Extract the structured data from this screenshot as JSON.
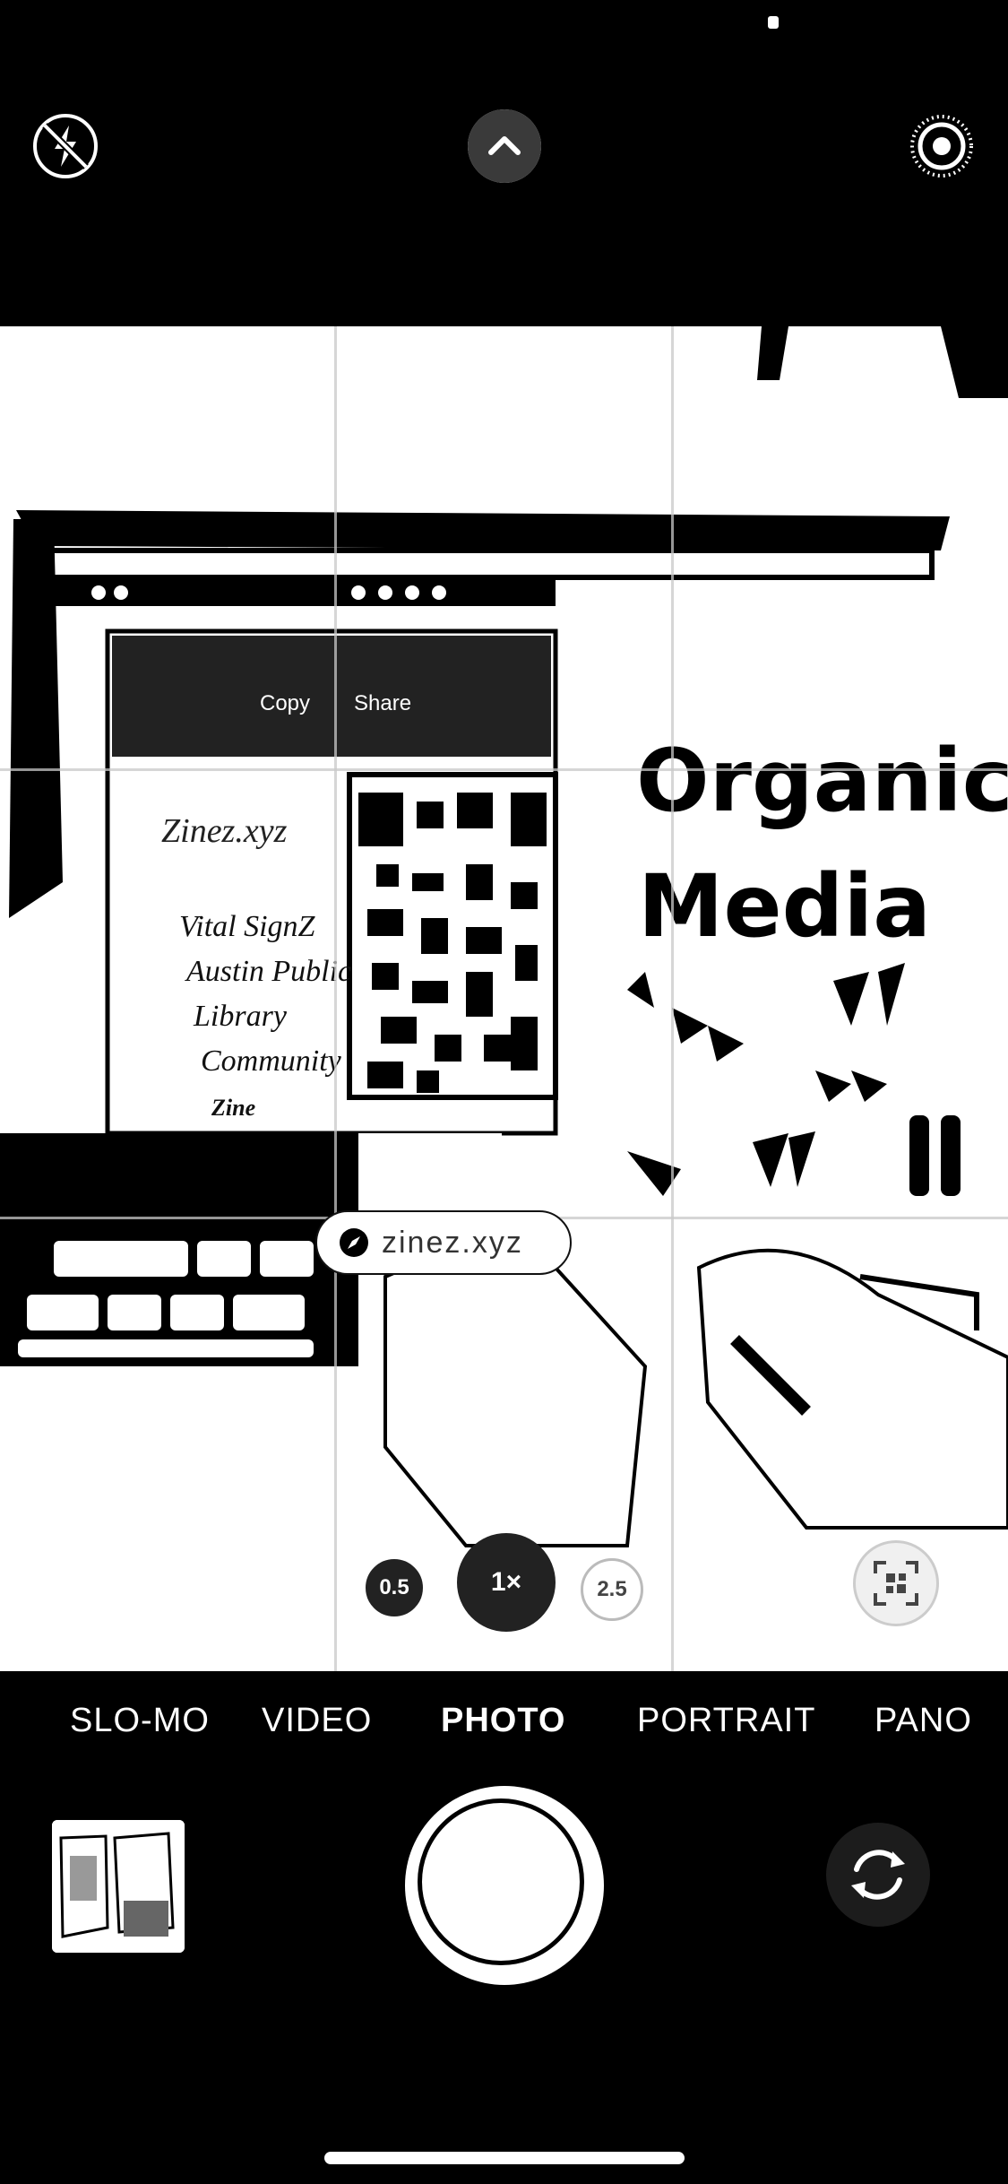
{
  "top_bar": {
    "flash_icon": "flash-off-icon",
    "chevron_icon": "chevron-up-icon",
    "live_icon": "live-photo-icon"
  },
  "viewfinder": {
    "scene_text": {
      "screen_title": "Zinez.xyz",
      "screen_lines": [
        "Vital SignZ",
        "Austin Public",
        "Library",
        "Community",
        "Zine"
      ],
      "screen_buttons": [
        "Copy",
        "Share"
      ],
      "poster_title_line1": "Organic",
      "poster_title_line2": "Media"
    },
    "link_chip": {
      "icon": "safari-compass-icon",
      "text": "zinez.xyz"
    },
    "zoom": {
      "wide": "0.5",
      "main": "1×",
      "tele": "2.5"
    },
    "qr_scan_icon": "qr-code-scan-icon"
  },
  "modes": [
    "SLO-MO",
    "VIDEO",
    "PHOTO",
    "PORTRAIT",
    "PANO"
  ],
  "active_mode": "PHOTO",
  "bottom": {
    "thumbnail_icon": "last-photo-thumbnail",
    "shutter_icon": "shutter-button",
    "flip_icon": "camera-flip-icon"
  }
}
